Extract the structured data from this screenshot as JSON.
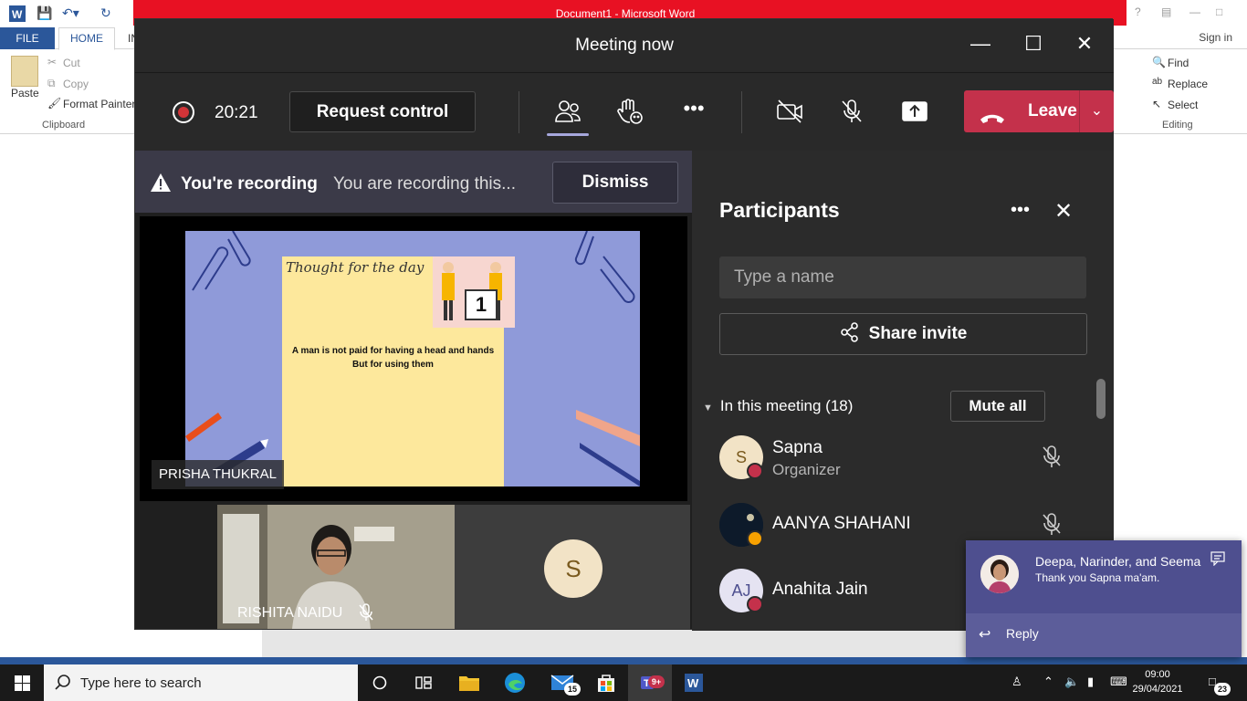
{
  "word": {
    "title": "Document1 -  Microsoft Word",
    "tabs": {
      "file": "FILE",
      "home": "HOME",
      "cut_trunc": "IN"
    },
    "signin": "Sign in",
    "paste": "Paste",
    "cut": "Cut",
    "copy": "Copy",
    "format_painter": "Format Painter",
    "clipboard_group": "Clipboard",
    "find": "Find",
    "replace": "Replace",
    "select": "Select",
    "editing_group": "Editing"
  },
  "meeting": {
    "title": "Meeting now",
    "timer": "20:21",
    "request_control": "Request control",
    "leave": "Leave",
    "recording_bold": "You're recording",
    "recording_text": "You are recording this...",
    "dismiss": "Dismiss",
    "slide_title": "Thought for the day",
    "slide_quote_1": "A man is not paid for having a head and hands",
    "slide_quote_2": "But for using them",
    "calendar_day": "1",
    "presenter": "PRISHA THUKRAL",
    "video_name": "RISHITA NAIDU",
    "tile_initial": "S"
  },
  "participants": {
    "title": "Participants",
    "search_placeholder": "Type a name",
    "share_invite": "Share invite",
    "in_meeting": "In this meeting (18)",
    "mute_all": "Mute all",
    "list": [
      {
        "initials": "S",
        "name": "Sapna",
        "role": "Organizer",
        "avatar_bg": "#f2e3c6",
        "avatar_fg": "#7a5a1e",
        "status": "#c4314b"
      },
      {
        "initials": "",
        "name": "AANYA SHAHANI",
        "role": "",
        "avatar_bg": "#0d1a2a",
        "avatar_fg": "#ffffff",
        "status": "#f8a100"
      },
      {
        "initials": "AJ",
        "name": "Anahita Jain",
        "role": "",
        "avatar_bg": "#e5e3f2",
        "avatar_fg": "#4d4f8f",
        "status": "#c4314b"
      }
    ]
  },
  "toast": {
    "from": "Deepa, Narinder, and Seema",
    "message": "Thank you Sapna ma'am.",
    "reply": "Reply"
  },
  "taskbar": {
    "search_placeholder": "Type here to search",
    "mail_badge": "15",
    "teams_badge": "9+",
    "time": "09:00",
    "date": "29/04/2021",
    "notif_count": "23"
  },
  "colors": {
    "leave": "#c4314b",
    "word_blue": "#2b579a",
    "toast": "#4e4f8f"
  }
}
